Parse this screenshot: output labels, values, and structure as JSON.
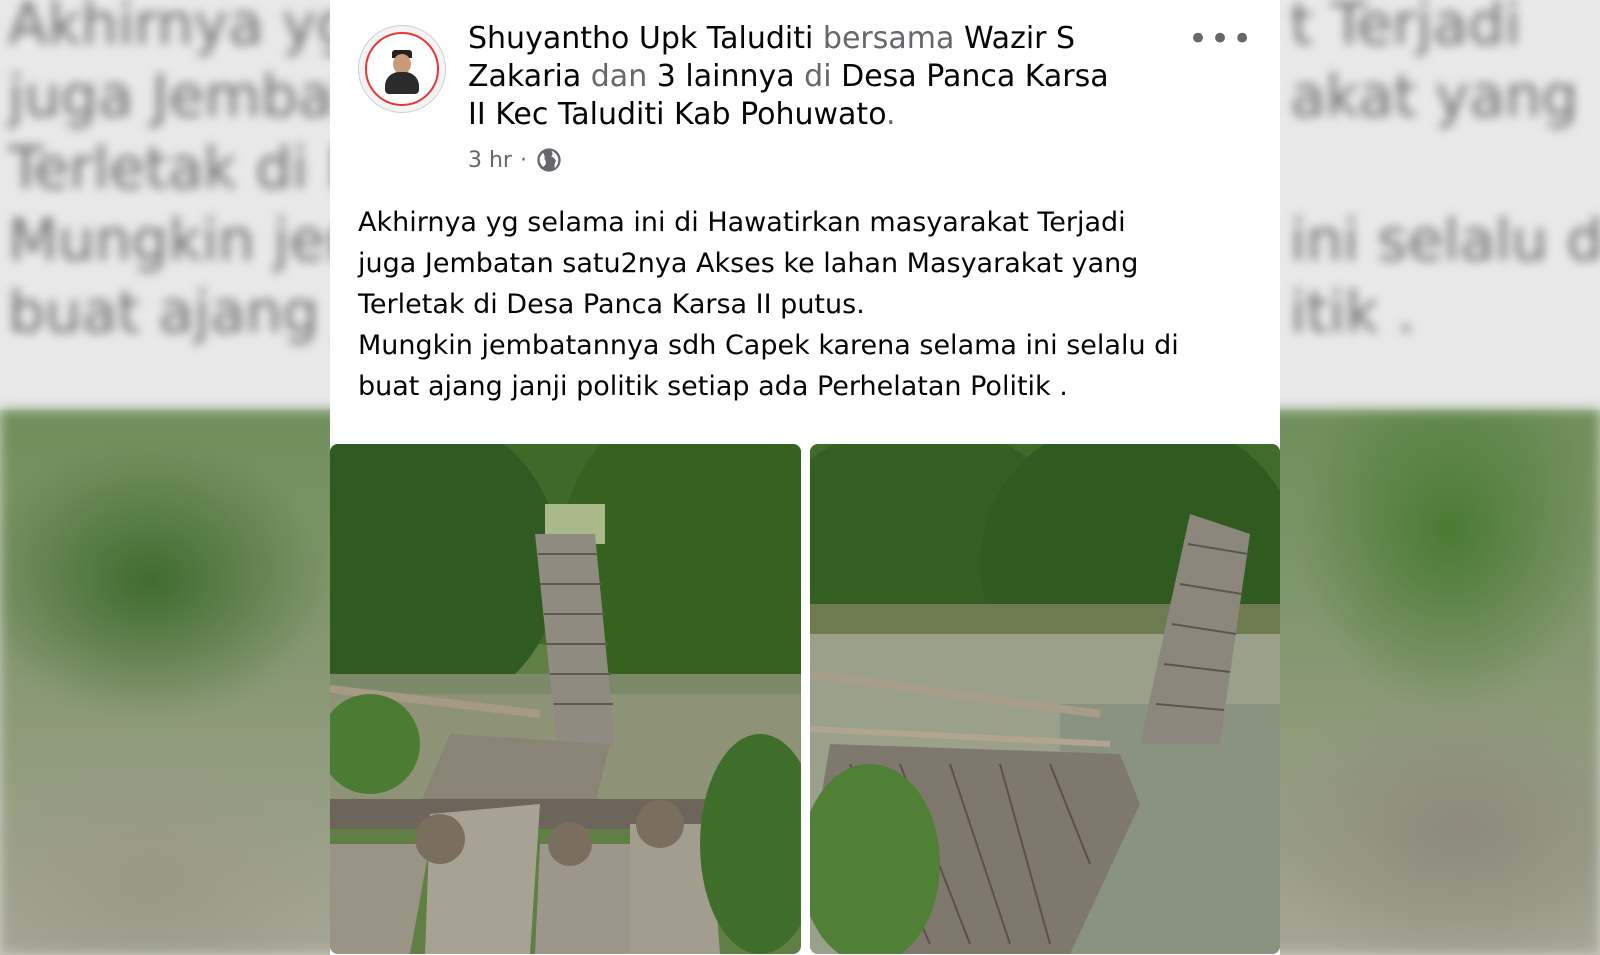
{
  "background": {
    "ghost_lines": [
      "Akhirnya yg",
      "juga Jembat",
      "Terletak di D",
      "Mungkin jem",
      "buat ajang ja"
    ],
    "ghost_lines_right": [
      "t Terjadi",
      "akat yang",
      "ini selalu di",
      "itik ."
    ]
  },
  "post": {
    "author": "Shuyantho Upk Taluditi",
    "with_word": "bersama",
    "tagged_person": "Wazir S Zakaria",
    "and_word": "dan",
    "others": "3 lainnya",
    "at_word": "di",
    "location": "Desa Panca Karsa II Kec Taluditi Kab Pohuwato",
    "period": ".",
    "time": "3 hr",
    "separator": "·",
    "privacy_icon": "globe-icon",
    "more_icon": "more-options-icon",
    "body_lines": [
      "Akhirnya yg selama ini di Hawatirkan masyarakat Terjadi",
      "juga Jembatan satu2nya Akses ke lahan Masyarakat yang",
      "Terletak di Desa Panca Karsa II putus.",
      "Mungkin jembatannya sdh Capek karena selama ini selalu di",
      "buat ajang janji politik setiap ada Perhelatan Politik ."
    ],
    "photos": [
      "broken-bridge-photo-1",
      "broken-bridge-photo-2"
    ]
  },
  "colors": {
    "text_primary": "#050505",
    "text_secondary": "#65676b",
    "card_bg": "#ffffff"
  }
}
